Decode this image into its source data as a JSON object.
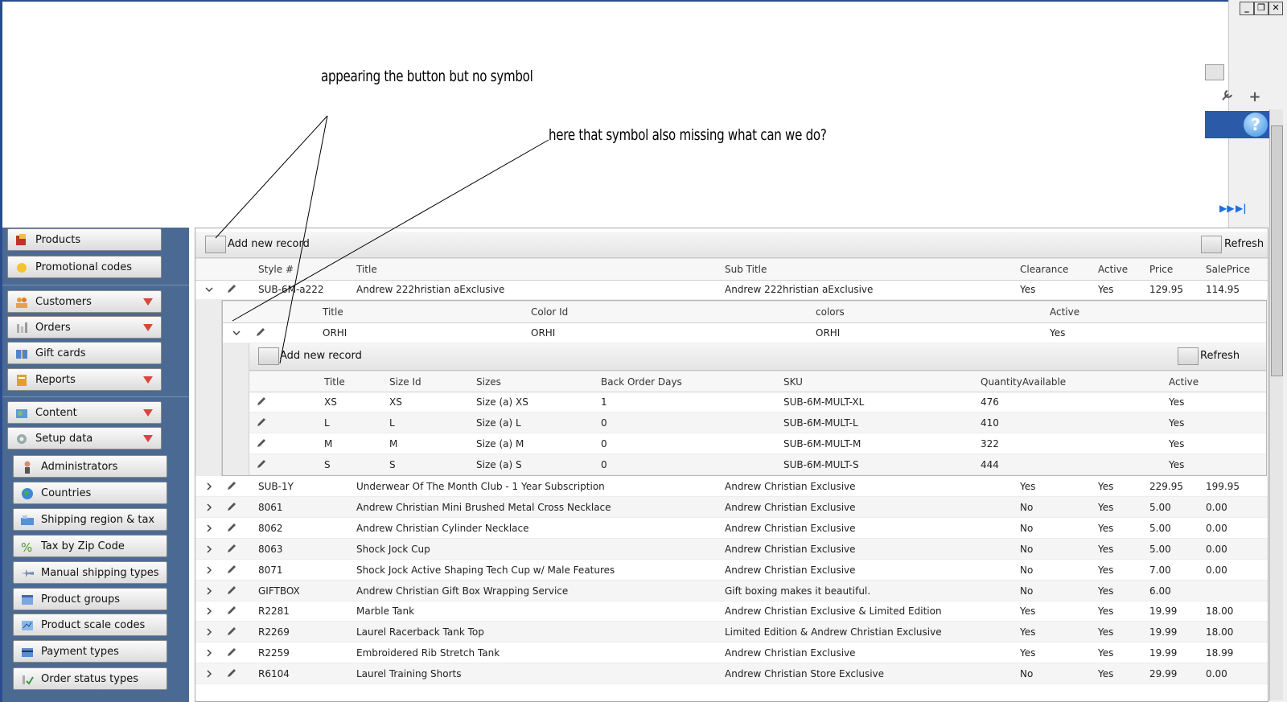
{
  "annotations": {
    "first": "appearing the button but no symbol",
    "second": "here that symbol also missing what can we do?"
  },
  "nav": {
    "top": [
      {
        "label": "Products",
        "icon": "products-icon"
      },
      {
        "label": "Promotional codes",
        "icon": "promo-icon"
      }
    ],
    "middle": [
      {
        "label": "Customers",
        "icon": "customers-icon"
      },
      {
        "label": "Orders",
        "icon": "orders-icon"
      },
      {
        "label": "Gift cards",
        "icon": "gift-cards-icon"
      },
      {
        "label": "Reports",
        "icon": "reports-icon"
      }
    ],
    "bottom": [
      {
        "label": "Content",
        "icon": "content-icon"
      },
      {
        "label": "Setup data",
        "icon": "setup-icon"
      }
    ],
    "setup_items": [
      {
        "label": "Administrators"
      },
      {
        "label": "Countries"
      },
      {
        "label": "Shipping region & tax"
      },
      {
        "label": "Tax by Zip Code"
      },
      {
        "label": "Manual shipping types"
      },
      {
        "label": "Product groups"
      },
      {
        "label": "Product scale codes"
      },
      {
        "label": "Payment types"
      },
      {
        "label": "Order status types"
      }
    ]
  },
  "toolbar": {
    "add_label": "Add new record",
    "refresh_label": "Refresh"
  },
  "main_headers": [
    "Style #",
    "Title",
    "Sub Title",
    "Clearance",
    "Active",
    "Price",
    "SalePrice"
  ],
  "expanded_row": {
    "style": "SUB-6M-a222",
    "title": "Andrew 222hristian aExclusive",
    "subtitle": "Andrew 222hristian aExclusive",
    "clearance": "Yes",
    "active": "Yes",
    "price": "129.95",
    "sale": "114.95"
  },
  "color_headers": [
    "Title",
    "Color Id",
    "colors",
    "Active"
  ],
  "color_row": {
    "title": "ORHI",
    "color_id": "ORHI",
    "colors": "ORHI",
    "active": "Yes"
  },
  "size_toolbar": {
    "add_label": "Add new record",
    "refresh_label": "Refresh"
  },
  "size_headers": [
    "Title",
    "Size Id",
    "Sizes",
    "Back Order Days",
    "SKU",
    "QuantityAvailable",
    "Active"
  ],
  "size_rows": [
    {
      "title": "XS",
      "size_id": "XS",
      "sizes": "Size (a) XS",
      "bod": "1",
      "sku": "SUB-6M-MULT-XL",
      "qty": "476",
      "active": "Yes"
    },
    {
      "title": "L",
      "size_id": "L",
      "sizes": "Size (a) L",
      "bod": "0",
      "sku": "SUB-6M-MULT-L",
      "qty": "410",
      "active": "Yes"
    },
    {
      "title": "M",
      "size_id": "M",
      "sizes": "Size (a) M",
      "bod": "0",
      "sku": "SUB-6M-MULT-M",
      "qty": "322",
      "active": "Yes"
    },
    {
      "title": "S",
      "size_id": "S",
      "sizes": "Size (a) S",
      "bod": "0",
      "sku": "SUB-6M-MULT-S",
      "qty": "444",
      "active": "Yes"
    }
  ],
  "rows": [
    {
      "style": "SUB-1Y",
      "title": "Underwear Of The Month Club - 1 Year Subscription",
      "subtitle": "Andrew Christian Exclusive",
      "clearance": "Yes",
      "active": "Yes",
      "price": "229.95",
      "sale": "199.95"
    },
    {
      "style": "8061",
      "title": "Andrew Christian Mini Brushed Metal Cross Necklace",
      "subtitle": "Andrew Christian Exclusive",
      "clearance": "No",
      "active": "Yes",
      "price": "5.00",
      "sale": "0.00"
    },
    {
      "style": "8062",
      "title": "Andrew Christian Cylinder Necklace",
      "subtitle": "Andrew Christian Exclusive",
      "clearance": "No",
      "active": "Yes",
      "price": "5.00",
      "sale": "0.00"
    },
    {
      "style": "8063",
      "title": "Shock Jock Cup",
      "subtitle": "Andrew Christian Exclusive",
      "clearance": "No",
      "active": "Yes",
      "price": "5.00",
      "sale": "0.00"
    },
    {
      "style": "8071",
      "title": "Shock Jock Active Shaping Tech Cup w/ Male Features",
      "subtitle": "Andrew Christian Exclusive",
      "clearance": "No",
      "active": "Yes",
      "price": "7.00",
      "sale": "0.00"
    },
    {
      "style": "GIFTBOX",
      "title": "Andrew Christian Gift Box Wrapping Service",
      "subtitle": "Gift boxing makes it beautiful.",
      "clearance": "No",
      "active": "Yes",
      "price": "6.00",
      "sale": ""
    },
    {
      "style": "R2281",
      "title": "Marble Tank",
      "subtitle": "Andrew Christian Exclusive & Limited Edition",
      "clearance": "Yes",
      "active": "Yes",
      "price": "19.99",
      "sale": "18.00"
    },
    {
      "style": "R2269",
      "title": "Laurel Racerback Tank Top",
      "subtitle": "Limited Edition & Andrew Christian Exclusive",
      "clearance": "Yes",
      "active": "Yes",
      "price": "19.99",
      "sale": "18.00"
    },
    {
      "style": "R2259",
      "title": "Embroidered Rib Stretch Tank",
      "subtitle": "Andrew Christian Exclusive",
      "clearance": "Yes",
      "active": "Yes",
      "price": "19.99",
      "sale": "18.99"
    },
    {
      "style": "R6104",
      "title": "Laurel Training Shorts",
      "subtitle": "Andrew Christian Store Exclusive",
      "clearance": "No",
      "active": "Yes",
      "price": "29.99",
      "sale": "0.00"
    }
  ]
}
